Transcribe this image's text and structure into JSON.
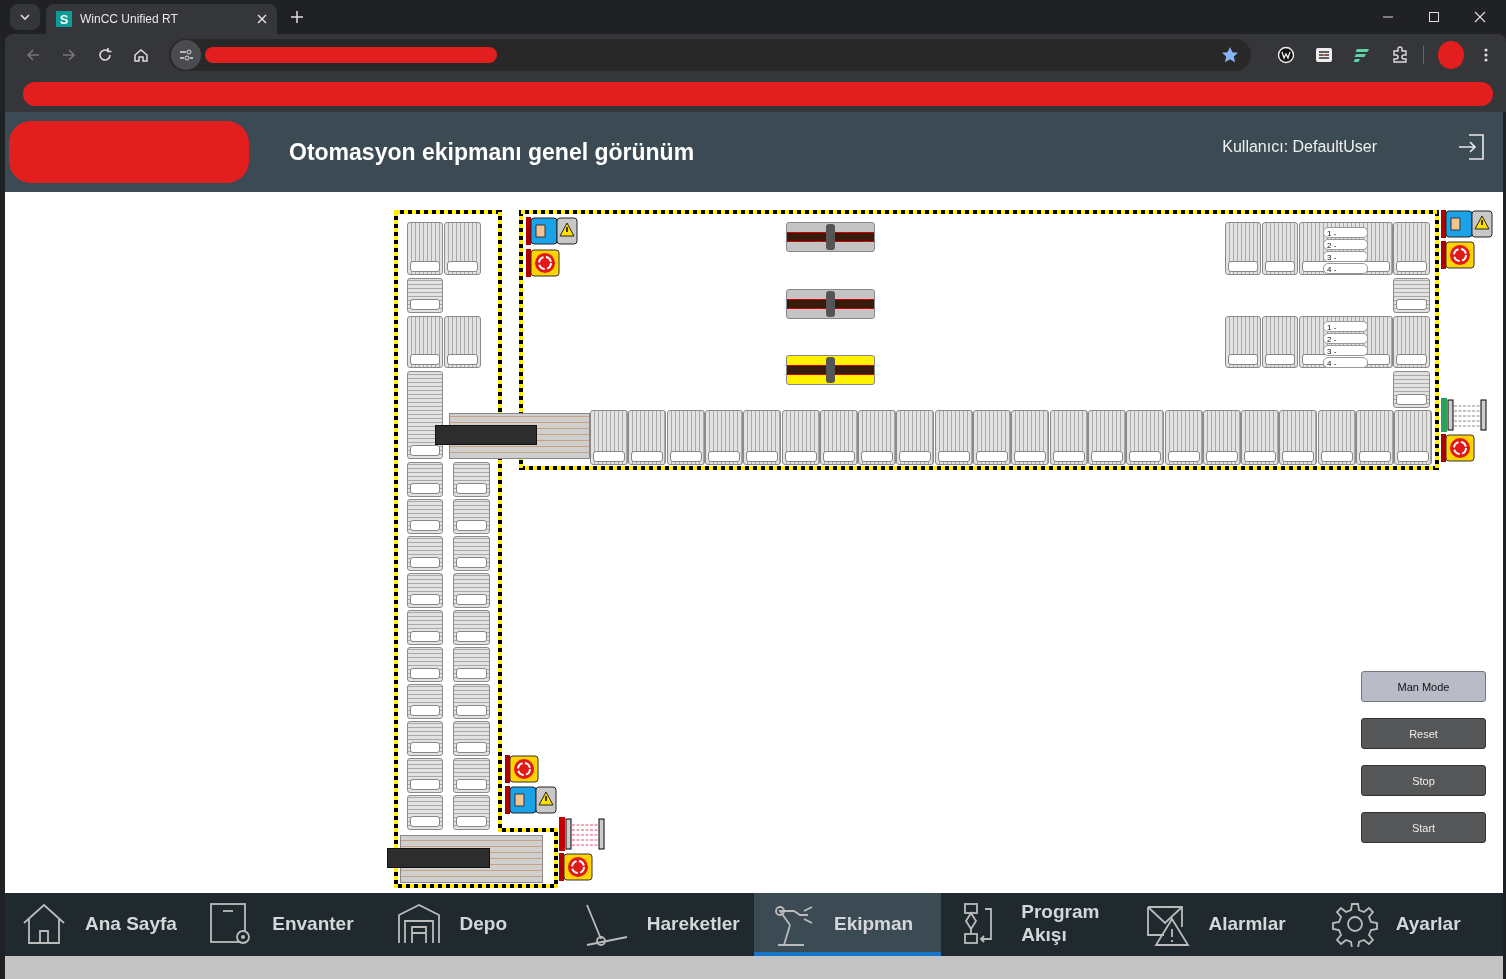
{
  "browser": {
    "tab": {
      "favicon": "S",
      "title": "WinCC Unified RT"
    }
  },
  "header": {
    "title": "Otomasyon ekipmanı genel görünüm",
    "user": "Kullanıcı: DefaultUser"
  },
  "stations": [
    {
      "active": false
    },
    {
      "active": false
    },
    {
      "active": true
    }
  ],
  "stacks": [
    {
      "labels": [
        "1 -",
        "2 -",
        "3 -",
        "4 -"
      ]
    },
    {
      "labels": [
        "1 -",
        "2 -",
        "3 -",
        "4 -"
      ]
    }
  ],
  "safety_devices": [
    {
      "kind": "manual"
    },
    {
      "kind": "estop"
    },
    {
      "kind": "manual"
    },
    {
      "kind": "estop"
    },
    {
      "kind": "light_curtain",
      "ok": true
    },
    {
      "kind": "estop"
    },
    {
      "kind": "estop"
    },
    {
      "kind": "manual"
    },
    {
      "kind": "light_curtain",
      "ok": false
    },
    {
      "kind": "estop"
    }
  ],
  "control_buttons": [
    {
      "label": "Man Mode",
      "active": true
    },
    {
      "label": "Reset",
      "active": false
    },
    {
      "label": "Stop",
      "active": false
    },
    {
      "label": "Start",
      "active": false
    }
  ],
  "nav": [
    {
      "label": "Ana Sayfa",
      "selected": false
    },
    {
      "label": "Envanter",
      "selected": false
    },
    {
      "label": "Depo",
      "selected": false
    },
    {
      "label": "Hareketler",
      "selected": false
    },
    {
      "label": "Ekipman",
      "selected": true
    },
    {
      "label": "Program\nAkışı",
      "selected": false
    },
    {
      "label": "Alarmlar",
      "selected": false
    },
    {
      "label": "Ayarlar",
      "selected": false
    }
  ]
}
